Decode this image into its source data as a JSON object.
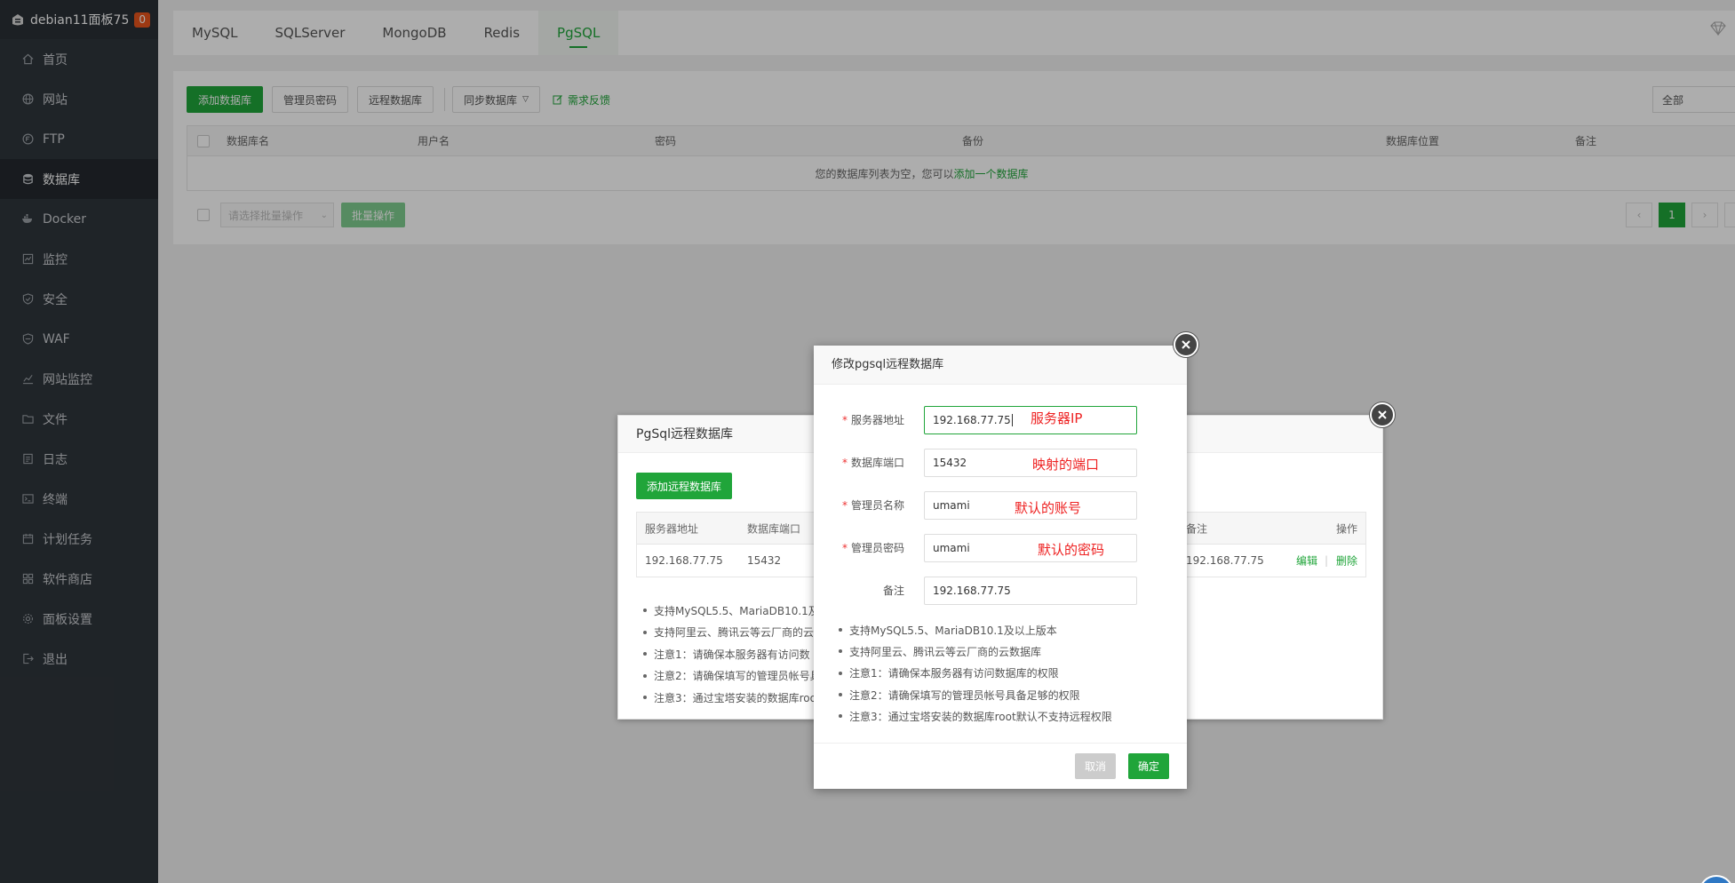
{
  "sidebar": {
    "brand": "debian11面板75",
    "badge": "0",
    "items": [
      {
        "label": "首页",
        "icon": "home-icon"
      },
      {
        "label": "网站",
        "icon": "globe-icon"
      },
      {
        "label": "FTP",
        "icon": "ftp-icon"
      },
      {
        "label": "数据库",
        "icon": "database-icon"
      },
      {
        "label": "Docker",
        "icon": "docker-icon"
      },
      {
        "label": "监控",
        "icon": "monitor-icon"
      },
      {
        "label": "安全",
        "icon": "shield-icon"
      },
      {
        "label": "WAF",
        "icon": "waf-icon"
      },
      {
        "label": "网站监控",
        "icon": "chart-icon"
      },
      {
        "label": "文件",
        "icon": "folder-icon"
      },
      {
        "label": "日志",
        "icon": "log-icon"
      },
      {
        "label": "终端",
        "icon": "terminal-icon"
      },
      {
        "label": "计划任务",
        "icon": "calendar-icon"
      },
      {
        "label": "软件商店",
        "icon": "store-icon"
      },
      {
        "label": "面板设置",
        "icon": "gear-icon"
      },
      {
        "label": "退出",
        "icon": "logout-icon"
      }
    ],
    "active_index": 3
  },
  "tabs": [
    "MySQL",
    "SQLServer",
    "MongoDB",
    "Redis",
    "PgSQL"
  ],
  "toolbar": {
    "add_db": "添加数据库",
    "admin_pwd": "管理员密码",
    "remote_db": "远程数据库",
    "sync_db": "同步数据库",
    "feedback": "需求反馈",
    "filter": "全部"
  },
  "table": {
    "headers": [
      "数据库名",
      "用户名",
      "密码",
      "备份",
      "数据库位置",
      "备注"
    ],
    "empty_text": "您的数据库列表为空，您可以",
    "empty_link": "添加一个数据库"
  },
  "footer": {
    "batch_placeholder": "请选择批量操作",
    "batch_btn": "批量操作",
    "page": "1"
  },
  "remote_dialog": {
    "title": "PgSql远程数据库",
    "add_btn": "添加远程数据库",
    "headers": {
      "host": "服务器地址",
      "port": "数据库端口",
      "remark": "备注",
      "ops": "操作"
    },
    "row": {
      "host": "192.168.77.75",
      "port": "15432",
      "remark": "192.168.77.75",
      "edit": "编辑",
      "sep": "|",
      "delete": "删除"
    },
    "tips": [
      "支持MySQL5.5、MariaDB10.1及",
      "支持阿里云、腾讯云等云厂商的云",
      "注意1：请确保本服务器有访问数",
      "注意2：请确保填写的管理员帐号具",
      "注意3：通过宝塔安装的数据库roo"
    ]
  },
  "edit_dialog": {
    "title": "修改pgsql远程数据库",
    "fields": [
      {
        "label": "服务器地址",
        "value": "192.168.77.75",
        "required": true,
        "note": "服务器IP"
      },
      {
        "label": "数据库端口",
        "value": "15432",
        "required": true,
        "note": "映射的端口"
      },
      {
        "label": "管理员名称",
        "value": "umami",
        "required": true,
        "note": "默认的账号"
      },
      {
        "label": "管理员密码",
        "value": "umami",
        "required": true,
        "note": "默认的密码"
      },
      {
        "label": "备注",
        "value": "192.168.77.75",
        "required": false,
        "note": ""
      }
    ],
    "required_mark": "*",
    "tips": [
      "支持MySQL5.5、MariaDB10.1及以上版本",
      "支持阿里云、腾讯云等云厂商的云数据库",
      "注意1：请确保本服务器有访问数据库的权限",
      "注意2：请确保填写的管理员帐号具备足够的权限",
      "注意3：通过宝塔安装的数据库root默认不支持远程权限"
    ],
    "cancel": "取消",
    "confirm": "确定"
  },
  "colors": {
    "accent": "#20a53a",
    "sidebar_bg": "#2f353b",
    "annotation": "#ee2222"
  }
}
